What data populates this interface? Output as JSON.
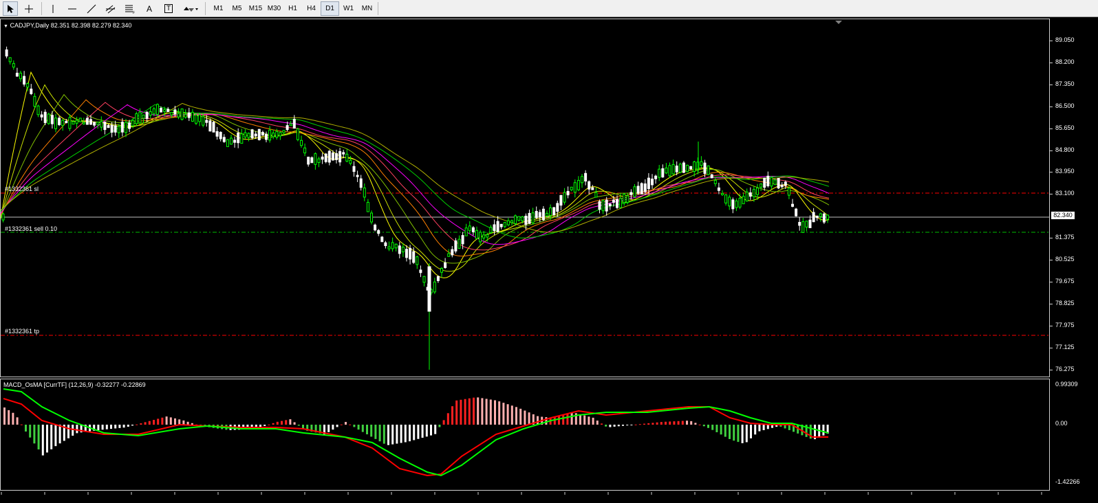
{
  "toolbar": {
    "tools": [
      {
        "name": "cursor-arrow-icon"
      },
      {
        "name": "crosshair-icon"
      },
      {
        "name": "vertical-line-icon"
      },
      {
        "name": "horizontal-line-icon"
      },
      {
        "name": "trendline-icon"
      },
      {
        "name": "equidistant-channel-icon"
      },
      {
        "name": "fibonacci-icon"
      },
      {
        "name": "text-icon",
        "glyph": "A"
      },
      {
        "name": "text-label-icon",
        "glyph": "T"
      },
      {
        "name": "arrows-icon"
      }
    ],
    "timeframes": [
      "M1",
      "M5",
      "M15",
      "M30",
      "H1",
      "H4",
      "D1",
      "W1",
      "MN"
    ],
    "active_timeframe": "D1"
  },
  "chart": {
    "header": "CADJPY,Daily  82.351 82.398 82.279 82.340",
    "price_scale": [
      "89.050",
      "88.200",
      "87.350",
      "86.500",
      "85.650",
      "84.800",
      "83.950",
      "83.100",
      "82.340",
      "81.375",
      "80.525",
      "79.675",
      "78.825",
      "77.975",
      "77.125",
      "76.275"
    ],
    "current_price": "82.340",
    "orders": {
      "sl_label": "#1332361 sl",
      "entry_label": "#1332361 sell 0.10",
      "tp_label": "#1332361 tp"
    },
    "colors": {
      "bull_candle": "#00ff00",
      "bear_candle": "#ffffff",
      "sl_line": "#ff0000",
      "tp_line": "#ff0000",
      "entry_line": "#00c000",
      "bid_line": "#c0c0c0"
    }
  },
  "indicator": {
    "header": "MACD_OsMA [CurrTF] (12,26,9) -0.32277 -0.22869",
    "scale": [
      "0.99309",
      "0.00",
      "-1.42266"
    ],
    "colors": {
      "macd_line": "#00ff00",
      "signal_line": "#ff0000"
    }
  }
}
